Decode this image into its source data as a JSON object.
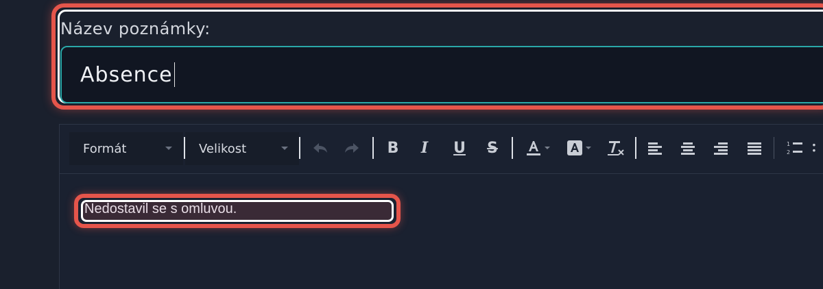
{
  "note_form": {
    "title_label": "Název poznámky:",
    "title_value": "Absence"
  },
  "toolbar": {
    "format_label": "Formát",
    "size_label": "Velikost",
    "buttons": {
      "undo": "undo-icon",
      "redo": "redo-icon",
      "bold": "B",
      "italic": "I",
      "underline": "U",
      "strike": "S"
    }
  },
  "editor": {
    "content": "Nedostavil se s omluvou."
  },
  "colors": {
    "highlight_outline": "#e5554b",
    "input_border": "#2aa8a8",
    "background": "#1a202d"
  }
}
